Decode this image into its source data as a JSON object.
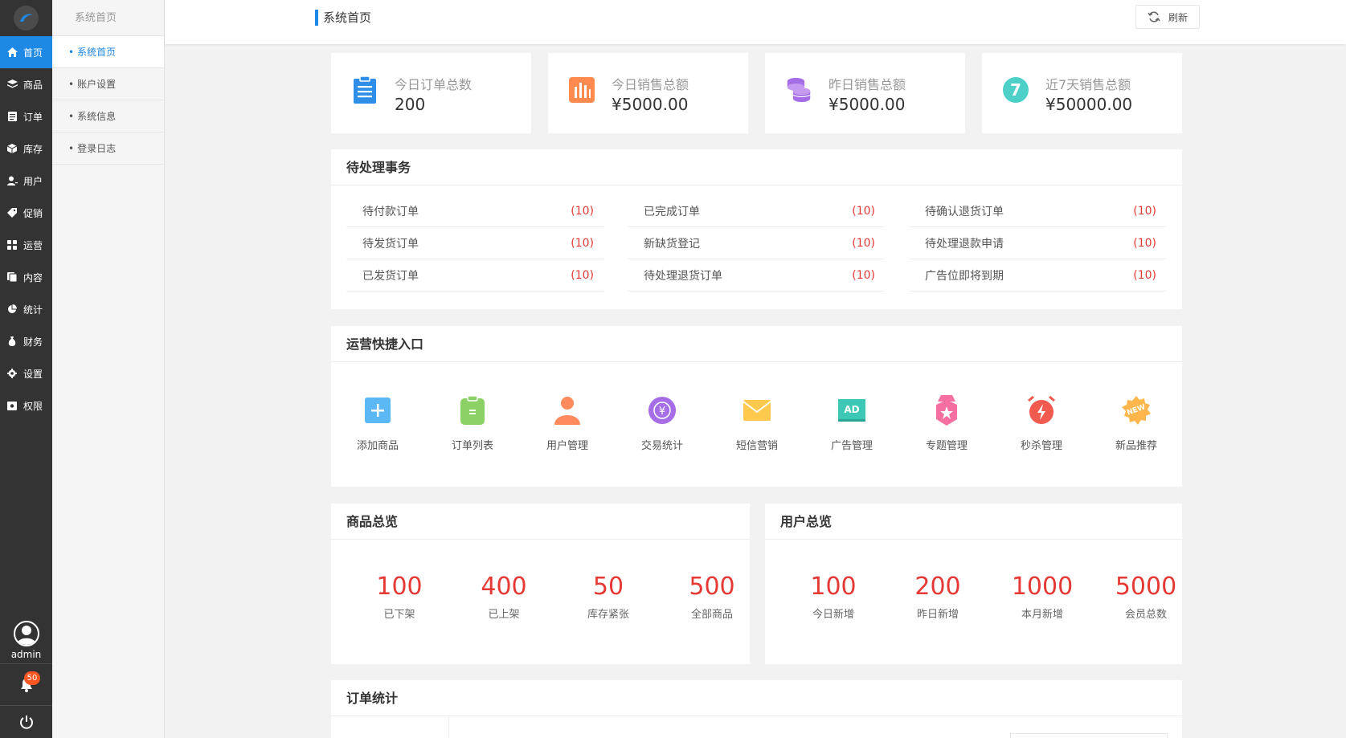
{
  "nav": {
    "items": [
      {
        "label": "首页",
        "icon": "home-icon"
      },
      {
        "label": "商品",
        "icon": "layers-icon"
      },
      {
        "label": "订单",
        "icon": "document-icon"
      },
      {
        "label": "库存",
        "icon": "box-icon"
      },
      {
        "label": "用户",
        "icon": "user-icon"
      },
      {
        "label": "促销",
        "icon": "tag-icon"
      },
      {
        "label": "运营",
        "icon": "grid-icon"
      },
      {
        "label": "内容",
        "icon": "copy-icon"
      },
      {
        "label": "统计",
        "icon": "pie-icon"
      },
      {
        "label": "财务",
        "icon": "money-bag-icon"
      },
      {
        "label": "设置",
        "icon": "gear-icon"
      },
      {
        "label": "权限",
        "icon": "lock-icon"
      }
    ],
    "admin_name": "admin",
    "notification_count": "50"
  },
  "subnav": {
    "title": "系统首页",
    "items": [
      {
        "label": "系统首页"
      },
      {
        "label": "账户设置"
      },
      {
        "label": "系统信息"
      },
      {
        "label": "登录日志"
      }
    ]
  },
  "topbar": {
    "breadcrumb": "系统首页",
    "refresh_label": "刷新"
  },
  "stats": [
    {
      "label": "今日订单总数",
      "value": "200",
      "icon": "clipboard-icon",
      "color": "#2f8fe8"
    },
    {
      "label": "今日销售总额",
      "value": "¥5000.00",
      "icon": "bar-chart-icon",
      "color": "#ff8a50"
    },
    {
      "label": "昨日销售总额",
      "value": "¥5000.00",
      "icon": "coins-icon",
      "color": "#a66ee6"
    },
    {
      "label": "近7天销售总额",
      "value": "¥50000.00",
      "icon": "seven-days-icon",
      "color": "#4dd0c8",
      "icon_text": "7"
    }
  ],
  "todo": {
    "title": "待处理事务",
    "columns": [
      [
        {
          "label": "待付款订单",
          "count": "(10)"
        },
        {
          "label": "待发货订单",
          "count": "(10)"
        },
        {
          "label": "已发货订单",
          "count": "(10)"
        }
      ],
      [
        {
          "label": "已完成订单",
          "count": "(10)"
        },
        {
          "label": "新缺货登记",
          "count": "(10)"
        },
        {
          "label": "待处理退货订单",
          "count": "(10)"
        }
      ],
      [
        {
          "label": "待确认退货订单",
          "count": "(10)"
        },
        {
          "label": "待处理退款申请",
          "count": "(10)"
        },
        {
          "label": "广告位即将到期",
          "count": "(10)"
        }
      ]
    ]
  },
  "quick": {
    "title": "运营快捷入口",
    "items": [
      {
        "label": "添加商品",
        "icon": "plus-square-icon",
        "color": "#5bb8f5"
      },
      {
        "label": "订单列表",
        "icon": "order-list-icon",
        "color": "#8bd165"
      },
      {
        "label": "用户管理",
        "icon": "user-manage-icon",
        "color": "#ff8a5c"
      },
      {
        "label": "交易统计",
        "icon": "yuan-coin-icon",
        "color": "#a66ee6"
      },
      {
        "label": "短信营销",
        "icon": "envelope-icon",
        "color": "#ffc94d"
      },
      {
        "label": "广告管理",
        "icon": "ad-icon",
        "color": "#3cc8b4",
        "icon_text": "AD"
      },
      {
        "label": "专题管理",
        "icon": "topic-badge-icon",
        "color": "#f56fa0"
      },
      {
        "label": "秒杀管理",
        "icon": "alarm-clock-icon",
        "color": "#f05a4f"
      },
      {
        "label": "新品推荐",
        "icon": "new-badge-icon",
        "color": "#ffb74d",
        "icon_text": "NEW"
      }
    ]
  },
  "product_overview": {
    "title": "商品总览",
    "items": [
      {
        "value": "100",
        "label": "已下架"
      },
      {
        "value": "400",
        "label": "已上架"
      },
      {
        "value": "50",
        "label": "库存紧张"
      },
      {
        "value": "500",
        "label": "全部商品"
      }
    ]
  },
  "user_overview": {
    "title": "用户总览",
    "items": [
      {
        "value": "100",
        "label": "今日新增"
      },
      {
        "value": "200",
        "label": "昨日新增"
      },
      {
        "value": "1000",
        "label": "本月新增"
      },
      {
        "value": "5000",
        "label": "会员总数"
      }
    ]
  },
  "order_stats": {
    "title": "订单统计"
  }
}
